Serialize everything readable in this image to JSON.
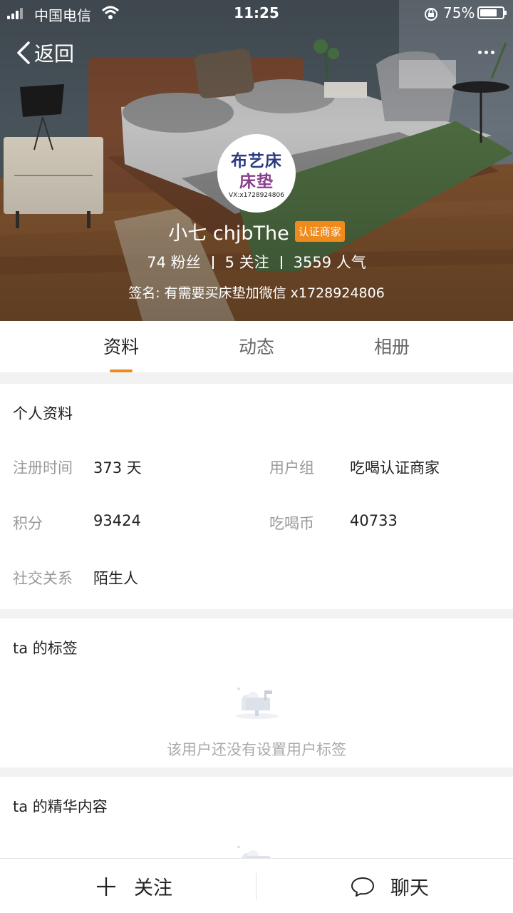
{
  "status_bar": {
    "carrier": "中国电信",
    "time": "11:25",
    "battery_percent": "75%",
    "battery_level": 0.75,
    "icons": [
      "signal-icon",
      "wifi-icon",
      "rotation-lock-icon",
      "battery-icon"
    ]
  },
  "nav": {
    "back_label": "返回",
    "more_icon": "more-icon"
  },
  "profile": {
    "avatar_line1": "布艺床",
    "avatar_line2": "床垫",
    "avatar_line3": "VX:x1728924806",
    "name": "小七 chjbThe",
    "badge": "认证商家",
    "stats": {
      "fans": "74 粉丝",
      "following": "5 关注",
      "popularity": "3559 人气"
    },
    "signature": "签名: 有需要买床垫加微信 x1728924806"
  },
  "tabs": [
    {
      "label": "资料",
      "active": true
    },
    {
      "label": "动态",
      "active": false
    },
    {
      "label": "相册",
      "active": false
    }
  ],
  "personal_info": {
    "title": "个人资料",
    "register_label": "注册时间",
    "register_value": "373 天",
    "group_label": "用户组",
    "group_value": "吃喝认证商家",
    "points_label": "积分",
    "points_value": "93424",
    "coins_label": "吃喝币",
    "coins_value": "40733",
    "relation_label": "社交关系",
    "relation_value": "陌生人"
  },
  "tags_section": {
    "title": "ta 的标签",
    "empty_text": "该用户还没有设置用户标签"
  },
  "featured_section": {
    "title": "ta 的精华内容"
  },
  "bottom_bar": {
    "follow_label": "关注",
    "chat_label": "聊天"
  },
  "colors": {
    "accent": "#f08a1c",
    "muted_text": "#999999",
    "primary_text": "#222222",
    "page_bg": "#f2f2f2"
  }
}
